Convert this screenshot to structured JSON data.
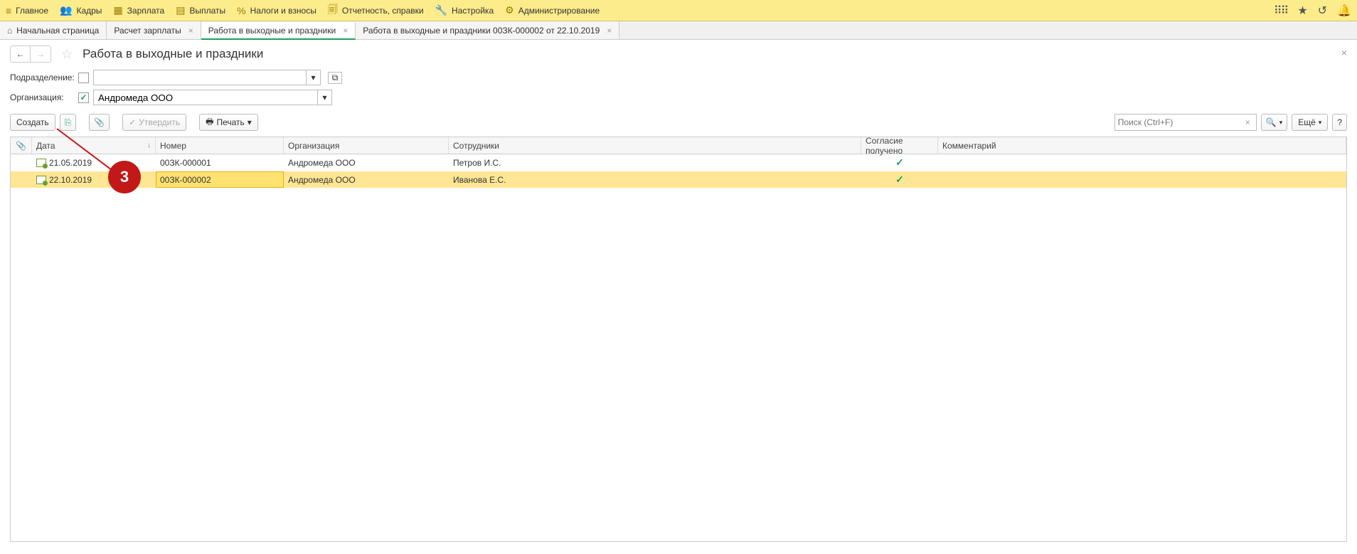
{
  "menu": {
    "items": [
      {
        "icon": "≡",
        "label": "Главное"
      },
      {
        "icon": "👥",
        "label": "Кадры"
      },
      {
        "icon": "▦",
        "label": "Зарплата"
      },
      {
        "icon": "▤",
        "label": "Выплаты"
      },
      {
        "icon": "%",
        "label": "Налоги и взносы"
      },
      {
        "icon": "🗐",
        "label": "Отчетность, справки"
      },
      {
        "icon": "🔧",
        "label": "Настройка"
      },
      {
        "icon": "⚙",
        "label": "Администрирование"
      }
    ]
  },
  "tabs": [
    {
      "icon": "⌂",
      "label": "Начальная страница",
      "closable": false
    },
    {
      "label": "Расчет зарплаты",
      "closable": true
    },
    {
      "label": "Работа в выходные и праздники",
      "closable": true,
      "active": true
    },
    {
      "label": "Работа в выходные и праздники 00ЗК-000002 от 22.10.2019",
      "closable": true
    }
  ],
  "page": {
    "title": "Работа в выходные и праздники"
  },
  "filters": {
    "dept_label": "Подразделение:",
    "dept_checked": false,
    "dept_value": "",
    "org_label": "Организация:",
    "org_checked": true,
    "org_value": "Андромеда ООО"
  },
  "toolbar": {
    "create": "Создать",
    "approve": "Утвердить",
    "print": "Печать",
    "more": "Ещё",
    "search_placeholder": "Поиск (Ctrl+F)"
  },
  "columns": {
    "attach": "",
    "date": "Дата",
    "num": "Номер",
    "org": "Организация",
    "emp": "Сотрудники",
    "consent": "Согласие получено",
    "comment": "Комментарий"
  },
  "rows": [
    {
      "date": "21.05.2019",
      "num": "00ЗК-000001",
      "org": "Андромеда ООО",
      "emp": "Петров И.С.",
      "consent": true,
      "selected": false
    },
    {
      "date": "22.10.2019",
      "num": "00ЗК-000002",
      "org": "Андромеда ООО",
      "emp": "Иванова Е.С.",
      "consent": true,
      "selected": true
    }
  ],
  "annotation": {
    "label": "3"
  }
}
